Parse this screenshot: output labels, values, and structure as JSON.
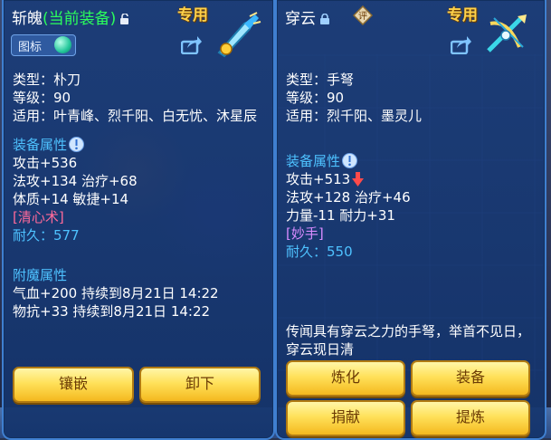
{
  "left_panel": {
    "name": "斩魄",
    "equipped_tag": "(当前装备)",
    "exclusive": "专用",
    "icon_toggle_label": "图标",
    "type": "类型：朴刀",
    "level": "等级：90",
    "applies": "适用：叶青峰、烈千阳、白无忧、沐星辰",
    "attr_title": "装备属性",
    "attr_lines": [
      "攻击+536",
      "法攻+134 治疗+68",
      "体质+14 敏捷+14"
    ],
    "skill": "[清心术]",
    "durability": "耐久：577",
    "enchant_title": "附魔属性",
    "enchant_lines": [
      "气血+200 持续到8月21日 14:22",
      "物抗+33 持续到8月21日 14:22"
    ],
    "buttons": {
      "inlay": "镶嵌",
      "unequip": "卸下"
    }
  },
  "right_panel": {
    "name": "穿云",
    "exclusive": "专用",
    "badge": "评",
    "type": "类型：手弩",
    "level": "等级：90",
    "applies": "适用：烈千阳、墨灵儿",
    "attr_title": "装备属性",
    "attr_line1": "攻击+513",
    "attr_lines": [
      "法攻+128 治疗+46",
      "力量-11 耐力+31"
    ],
    "skill": "[妙手]",
    "durability": "耐久：550",
    "description": "传闻具有穿云之力的手弩，举首不见日，穿云现日清",
    "buttons": {
      "refine": "炼化",
      "equip": "装备",
      "donate": "捐献",
      "extract": "提炼"
    }
  },
  "colors": {
    "equipped": "#2bff5c",
    "exclusive": "#ffd24a",
    "section": "#4ec2ff",
    "skill": "#ff6a9a",
    "button": "#ffe15a"
  }
}
